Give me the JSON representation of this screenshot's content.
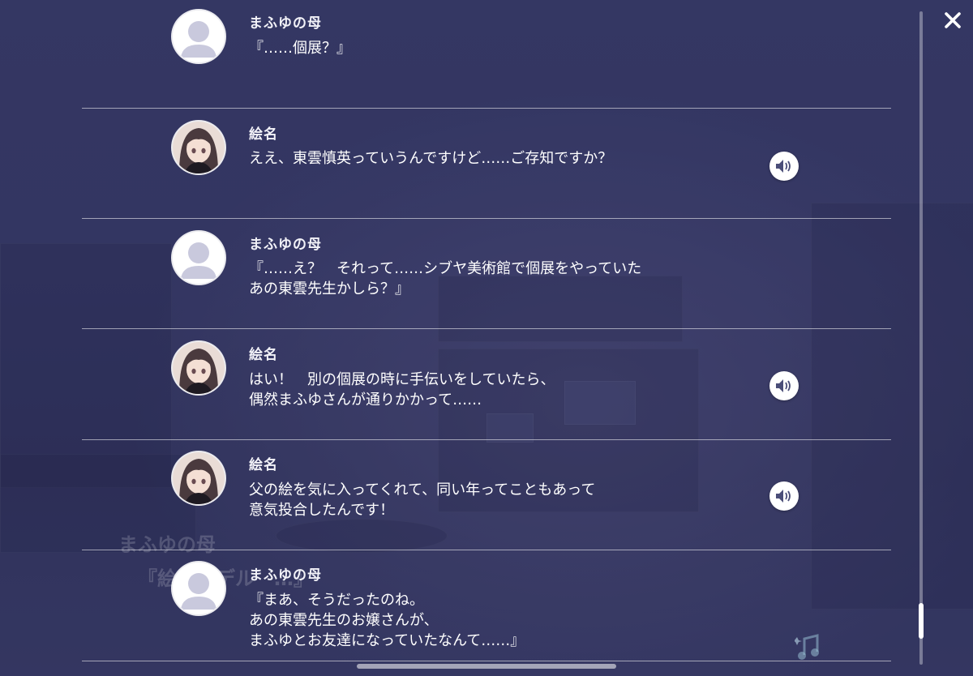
{
  "background_ghost": {
    "name": "まふゆの母",
    "text": "『絵の　デル　…』"
  },
  "log": [
    {
      "speaker": "まふゆの母",
      "avatar": "placeholder-avatar",
      "lines": [
        "『……個展？』"
      ],
      "voice": false
    },
    {
      "speaker": "絵名",
      "avatar": "ena-avatar",
      "lines": [
        "ええ、東雲慎英っていうんですけど……ご存知ですか？"
      ],
      "voice": true
    },
    {
      "speaker": "まふゆの母",
      "avatar": "placeholder-avatar",
      "lines": [
        "『……え？　それって……シブヤ美術館で個展をやっていた",
        "あの東雲先生かしら？』"
      ],
      "voice": false
    },
    {
      "speaker": "絵名",
      "avatar": "ena-avatar",
      "lines": [
        "はい！　別の個展の時に手伝いをしていたら、",
        "偶然まふゆさんが通りかかって……"
      ],
      "voice": true
    },
    {
      "speaker": "絵名",
      "avatar": "ena-avatar",
      "lines": [
        "父の絵を気に入ってくれて、同い年ってこともあって",
        "意気投合したんです！"
      ],
      "voice": true
    },
    {
      "speaker": "まふゆの母",
      "avatar": "placeholder-avatar",
      "lines": [
        "『まあ、そうだったのね。",
        "あの東雲先生のお嬢さんが、",
        "まふゆとお友達になっていたなんて……』"
      ],
      "voice": false
    }
  ],
  "icons": {
    "close": "close-icon",
    "voice": "speaker-icon",
    "note": "music-note-icon"
  },
  "colors": {
    "background": "#3a3d68",
    "divider": "#d8d8e8",
    "text": "#ffffff"
  }
}
